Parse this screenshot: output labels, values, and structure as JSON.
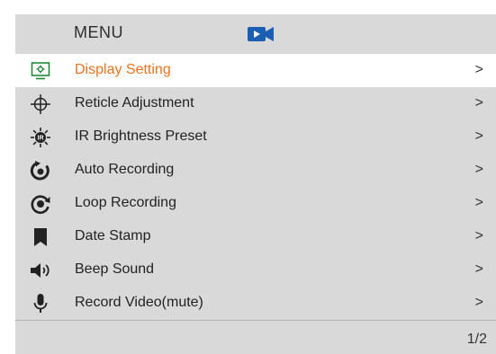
{
  "menu": {
    "title": "MENU",
    "title_icon": "video-camera-icon",
    "accent_color": "#e8731e",
    "icon_accent_color": "#1a5fb4",
    "items": [
      {
        "label": "Display Setting",
        "icon": "display-settings-icon",
        "selected": true
      },
      {
        "label": "Reticle  Adjustment",
        "icon": "crosshair-icon",
        "selected": false
      },
      {
        "label": "IR Brightness Preset",
        "icon": "ir-brightness-icon",
        "selected": false
      },
      {
        "label": "Auto Recording",
        "icon": "auto-record-icon",
        "selected": false
      },
      {
        "label": "Loop Recording",
        "icon": "loop-record-icon",
        "selected": false
      },
      {
        "label": "Date Stamp",
        "icon": "bookmark-icon",
        "selected": false
      },
      {
        "label": "Beep Sound",
        "icon": "speaker-icon",
        "selected": false
      },
      {
        "label": "Record Video(mute)",
        "icon": "microphone-icon",
        "selected": false
      }
    ],
    "chevron": ">",
    "page_indicator": "1/2"
  }
}
